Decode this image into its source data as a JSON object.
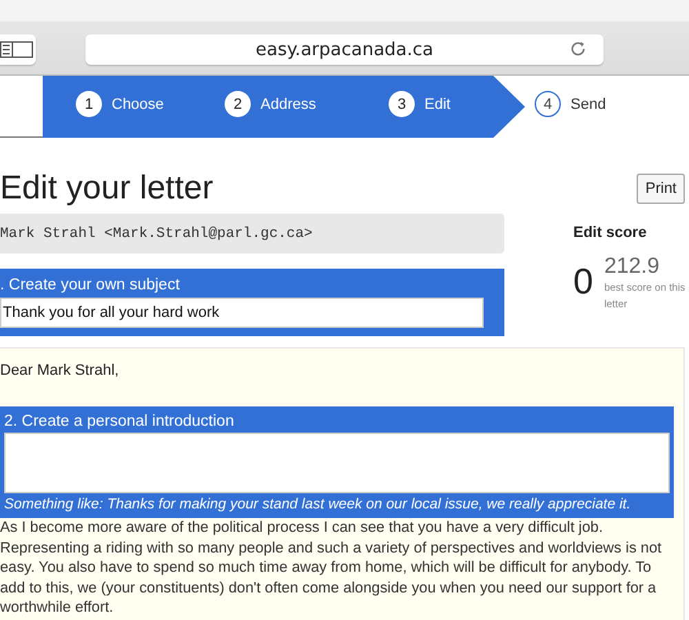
{
  "browser": {
    "address": "easy.arpacanada.ca"
  },
  "steps": [
    {
      "number": "1",
      "label": "Choose",
      "completed": true
    },
    {
      "number": "2",
      "label": "Address",
      "completed": true
    },
    {
      "number": "3",
      "label": "Edit",
      "completed": true
    },
    {
      "number": "4",
      "label": "Send",
      "completed": false
    }
  ],
  "heading": "Edit your letter",
  "print_button": "Print",
  "recipient": "Mark Strahl <Mark.Strahl@parl.gc.ca>",
  "subject": {
    "label": ". Create your own subject",
    "value": "Thank you for all your hard work"
  },
  "score": {
    "title": "Edit score",
    "value": "0",
    "best": "212.9",
    "best_caption": "best score on this letter"
  },
  "letter": {
    "greeting": "Dear Mark Strahl,",
    "introduction": {
      "label": "2. Create a personal introduction",
      "hint": "Something like: Thanks for making your stand last week on our local issue, we really appreciate it."
    },
    "body": "As I become more aware of the political process I can see that you have a very difficult job. Representing a riding with so many people and such a variety of perspectives and worldviews is not easy. You also have to spend so much time away from home, which will be difficult for anybody. To add to this, we (your constituents) don't often come alongside you when you need our support for a worthwhile effort."
  }
}
